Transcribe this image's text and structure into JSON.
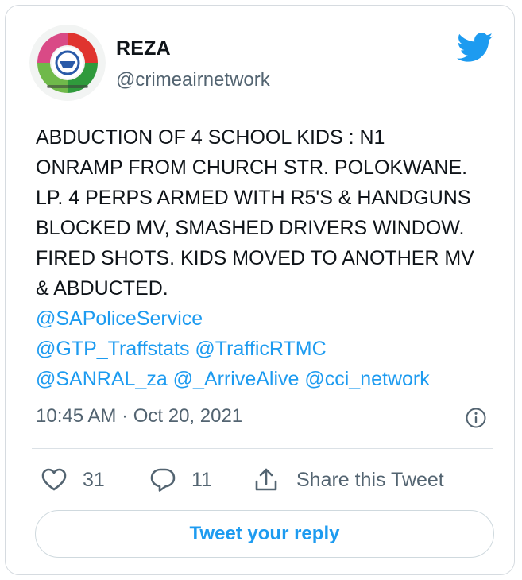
{
  "tweet": {
    "author": {
      "display_name": "REZA",
      "handle": "@crimeairnetwork",
      "avatar_icon": "crime-air-network-logo"
    },
    "body_lines": [
      "ABDUCTION OF 4 SCHOOL KIDS :  N1",
      "ONRAMP FROM CHURCH STR. POLOKWANE.",
      "LP. 4 PERPS ARMED WITH R5'S & HANDGUNS",
      "BLOCKED MV, SMASHED DRIVERS WINDOW.",
      "FIRED SHOTS. KIDS MOVED TO ANOTHER MV",
      "& ABDUCTED."
    ],
    "mention_lines": [
      "@SAPoliceService",
      "@GTP_Traffstats @TrafficRTMC",
      "@SANRAL_za @_ArriveAlive @cci_network"
    ],
    "timestamp": "10:45 AM · Oct 20, 2021",
    "likes": "31",
    "replies": "11",
    "share_label": "Share this Tweet",
    "reply_button_label": "Tweet your reply"
  },
  "icons": {
    "brand": "twitter-bird-icon",
    "info": "info-icon",
    "like": "heart-icon",
    "reply": "comment-icon",
    "share": "share-icon"
  },
  "colors": {
    "brand_blue": "#1d9bf0",
    "text_primary": "#0f1419",
    "text_secondary": "#536471",
    "border": "#d6dbe0"
  }
}
